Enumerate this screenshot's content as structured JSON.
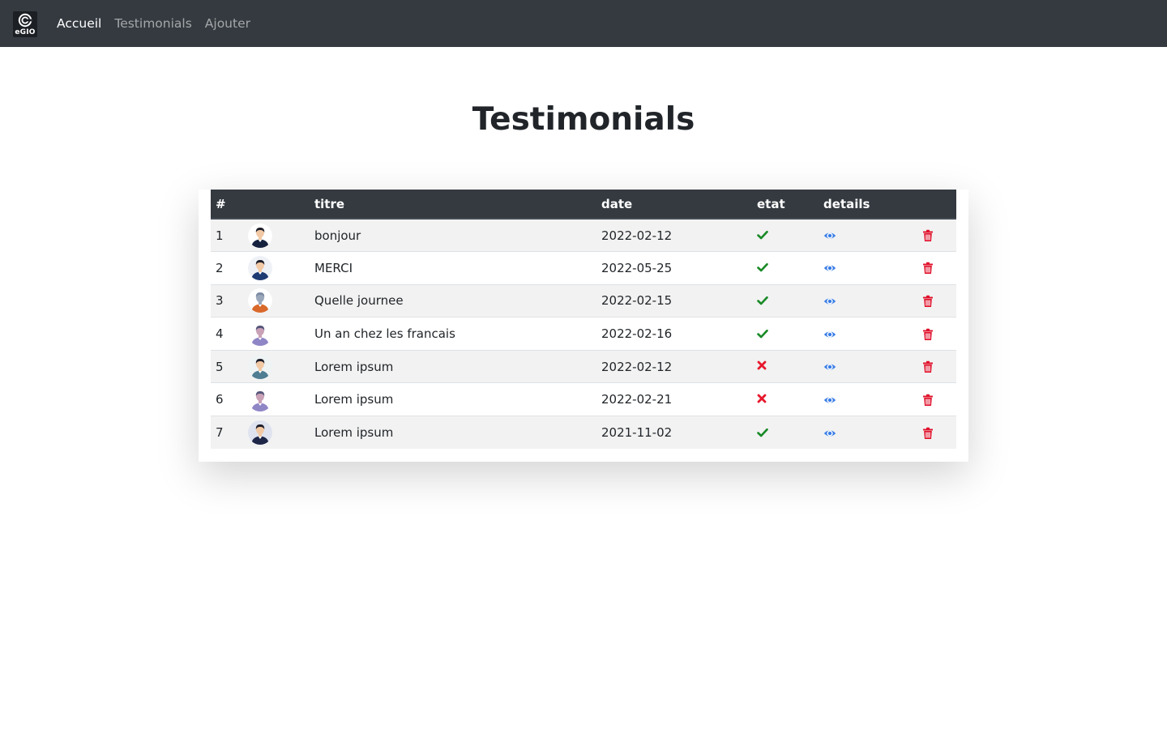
{
  "navbar": {
    "logo_text": "eGIO",
    "links": [
      {
        "label": "Accueil",
        "active": true
      },
      {
        "label": "Testimonials",
        "active": false
      },
      {
        "label": "Ajouter",
        "active": false
      }
    ]
  },
  "page": {
    "title": "Testimonials"
  },
  "table": {
    "headers": {
      "num": "#",
      "image": "",
      "titre": "titre",
      "date": "date",
      "etat": "etat",
      "details": "details",
      "actions": ""
    },
    "rows": [
      {
        "num": "1",
        "titre": "bonjour",
        "date": "2022-02-12",
        "etat": "check-icon",
        "avatar": {
          "bg": "#ffffff",
          "hair": "#1e1e2a",
          "skin": "#f2c9a5",
          "shirt": "#16213e"
        }
      },
      {
        "num": "2",
        "titre": "MERCI",
        "date": "2022-05-25",
        "etat": "check-icon",
        "avatar": {
          "bg": "#eef1f6",
          "hair": "#1e1e2a",
          "skin": "#f2c9a5",
          "shirt": "#1d3a73"
        }
      },
      {
        "num": "3",
        "titre": "Quelle journee",
        "date": "2022-02-15",
        "etat": "check-icon",
        "avatar": {
          "bg": "#ffffff",
          "hair": "#7c8aa3",
          "skin": "#9aa6ba",
          "shirt": "#d9692b"
        }
      },
      {
        "num": "4",
        "titre": "Un an chez les francais",
        "date": "2022-02-16",
        "etat": "check-icon",
        "avatar": {
          "bg": "#ffffff",
          "hair": "#55557a",
          "skin": "#c9a2b7",
          "shirt": "#8f86c6"
        }
      },
      {
        "num": "5",
        "titre": "Lorem ipsum",
        "date": "2022-02-12",
        "etat": "cross-icon",
        "avatar": {
          "bg": "#eef3f4",
          "hair": "#1e1e2a",
          "skin": "#f2c9a5",
          "shirt": "#4f7d92"
        }
      },
      {
        "num": "6",
        "titre": "Lorem ipsum",
        "date": "2022-02-21",
        "etat": "cross-icon",
        "avatar": {
          "bg": "#ffffff",
          "hair": "#55557a",
          "skin": "#c9a2b7",
          "shirt": "#8f86c6"
        }
      },
      {
        "num": "7",
        "titre": "Lorem ipsum",
        "date": "2021-11-02",
        "etat": "check-icon",
        "avatar": {
          "bg": "#dfe3ef",
          "hair": "#1e1e2a",
          "skin": "#f2c9a5",
          "shirt": "#1e2748"
        }
      }
    ]
  },
  "colors": {
    "navbar_bg": "#343a40",
    "check": "#198a27",
    "cross": "#e8182c",
    "eye": "#3a7ee6",
    "trash": "#e0102a"
  }
}
